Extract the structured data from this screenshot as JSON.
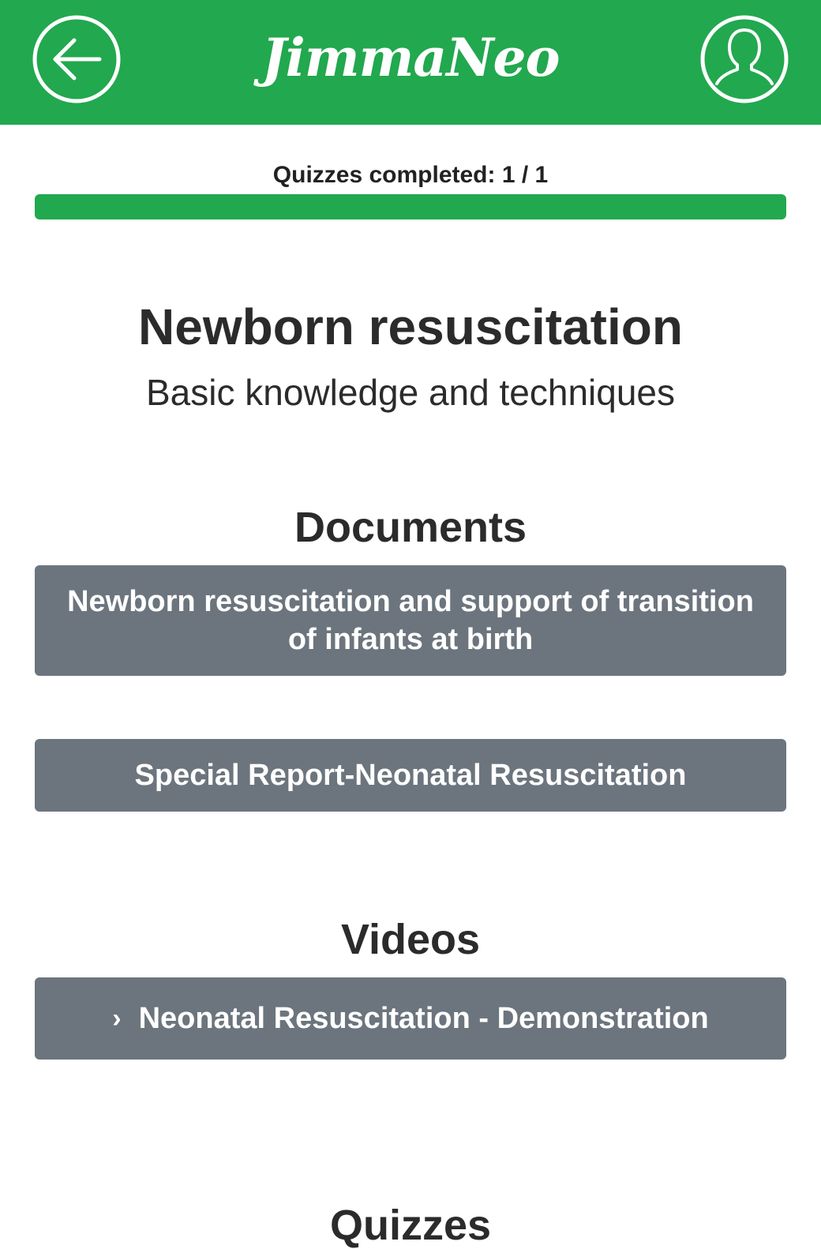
{
  "header": {
    "brand": "JimmaNeo",
    "back_icon": "arrow-left-circle-icon",
    "profile_icon": "user-circle-icon",
    "background_color": "#22a84e"
  },
  "progress": {
    "label": "Quizzes completed: 1 / 1",
    "completed": 1,
    "total": 1,
    "fraction": 1.0,
    "color": "#22a84e"
  },
  "course": {
    "title": "Newborn resuscitation",
    "subtitle": "Basic knowledge and techniques"
  },
  "documents": {
    "heading": "Documents",
    "items": [
      {
        "label": "Newborn resuscitation and support of transition of infants at birth"
      },
      {
        "label": "Special Report-Neonatal Resuscitation"
      }
    ]
  },
  "videos": {
    "heading": "Videos",
    "items": [
      {
        "label": "Neonatal Resuscitation - Demonstration",
        "icon": "chevron-right-icon",
        "chevron_glyph": "›"
      }
    ]
  },
  "quizzes": {
    "heading": "Quizzes"
  },
  "colors": {
    "button_background": "#6c757d",
    "text": "#2b2b2b"
  }
}
